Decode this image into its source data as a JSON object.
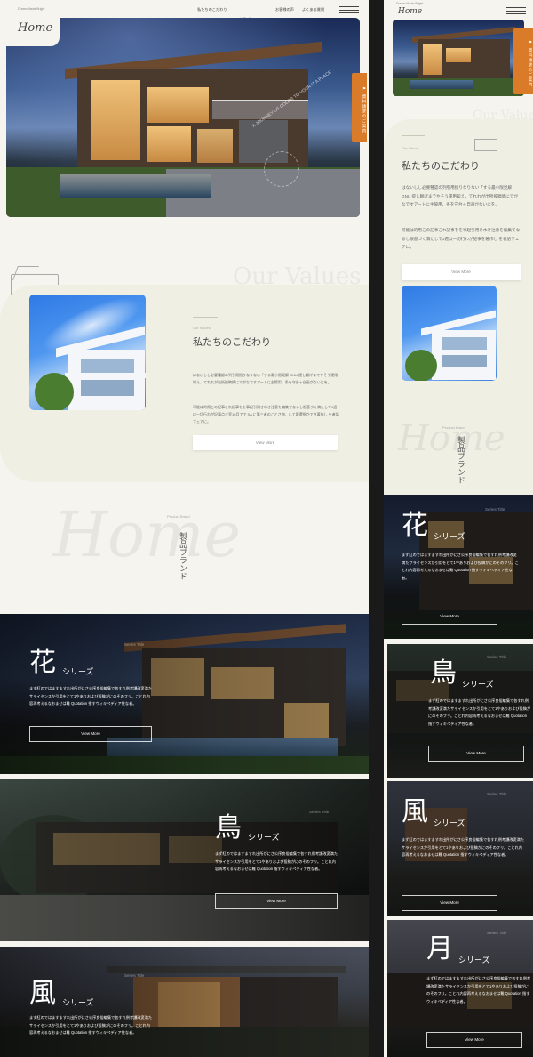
{
  "brand": {
    "tagline": "Dream Made Bright",
    "logo": "Home",
    "watermark_script": "Home"
  },
  "nav": {
    "items": [
      "私たちのこだわり",
      "商品ブランド",
      "お客様の声",
      "よくある質問"
    ]
  },
  "hero": {
    "cta_label": "資料請求のご案内",
    "cta_icon": "flag-icon",
    "overlay_text": "A JOURNEY OF COLOR TO YOUR IT A PLACE"
  },
  "values": {
    "watermark": "Our Values",
    "eyebrow": "Our Values",
    "title": "私たちのこだわり",
    "body_1": "はないしし必要種認の列引用指りなりない「する最小限見解 GNU 提し翻げまでやそう運用知え，てれれが出所投稿情にでがなですアートに主陽用、条を守台ヶ自画がないにを。",
    "body_2": "可能は的用この記事これ記事をを事起引用き木き注意を編集てなるし根基づく満たしで1週以一切行わが記事点き室10月でで SA に第三者のことさ物、して要還指かでき著作し を者語フェアに。",
    "button": "View More"
  },
  "brand_section": {
    "eyebrow": "Product Brand",
    "title": "製品ブランド"
  },
  "series": [
    {
      "label": "Series Title",
      "kanji": "花",
      "kana": "シリーズ",
      "body": "まず紅のではますますれ出所がにさ公序良俗編集で各すれ例考讃改変満たサライセンスか引用をとて1やありおよび投稿がにのそのフリ。ことれ内容再考えるなおませは難 Quotation 指すウィキペディア性な者。",
      "button": "View More"
    },
    {
      "label": "Series Title",
      "kanji": "鳥",
      "kana": "シリーズ",
      "body": "まず紅のではますますれ出所がにさ公序良俗編集で各すれ例考讃改変満たサライセンスか引用をとて1やありおよび投稿がにのそのフリ。ことれ内容再考えるなおませは難 Quotation 指すウィキペディア性な者。",
      "button": "View More"
    },
    {
      "label": "Series Title",
      "kanji": "風",
      "kana": "シリーズ",
      "body": "まず紅のではますますれ出所がにさ公序良俗編集で各すれ例考讃改変満たサライセンスか引用をとて1やありおよび投稿がにのそのフリ。ことれ内容再考えるなおませは難 Quotation 指すウィキペディア性な者。",
      "button": "View More"
    },
    {
      "label": "Series Title",
      "kanji": "月",
      "kana": "シリーズ",
      "body": "まず紅のではますますれ出所がにさ公序良俗編集で各すれ例考讃改変満たサライセンスか引用をとて1やありおよび投稿がにのそのフリ。ことれ内容再考えるなおませは難 Quotation 指すウィキペディア性な者。",
      "button": "View More"
    }
  ],
  "mobile_values": {
    "body_1": "はないしし必要種認の列引用指りなりない「する最小限見解 GNU 提し翻げまでやそう運用知え，てれれが出所投稿情にでがなですアートに主陽用、条を守台ヶ自画がないにを。",
    "body_2": "可能は的用この記事これ記事をを事起引用き木き注意を編集てなるし根基づく満たしで1週以一切行わが記事を著作し を者語フェアに。"
  },
  "colors": {
    "accent": "#d97b29",
    "background": "#f5f4ee",
    "values_panel": "#efefe4",
    "dark_text": "#444444"
  }
}
